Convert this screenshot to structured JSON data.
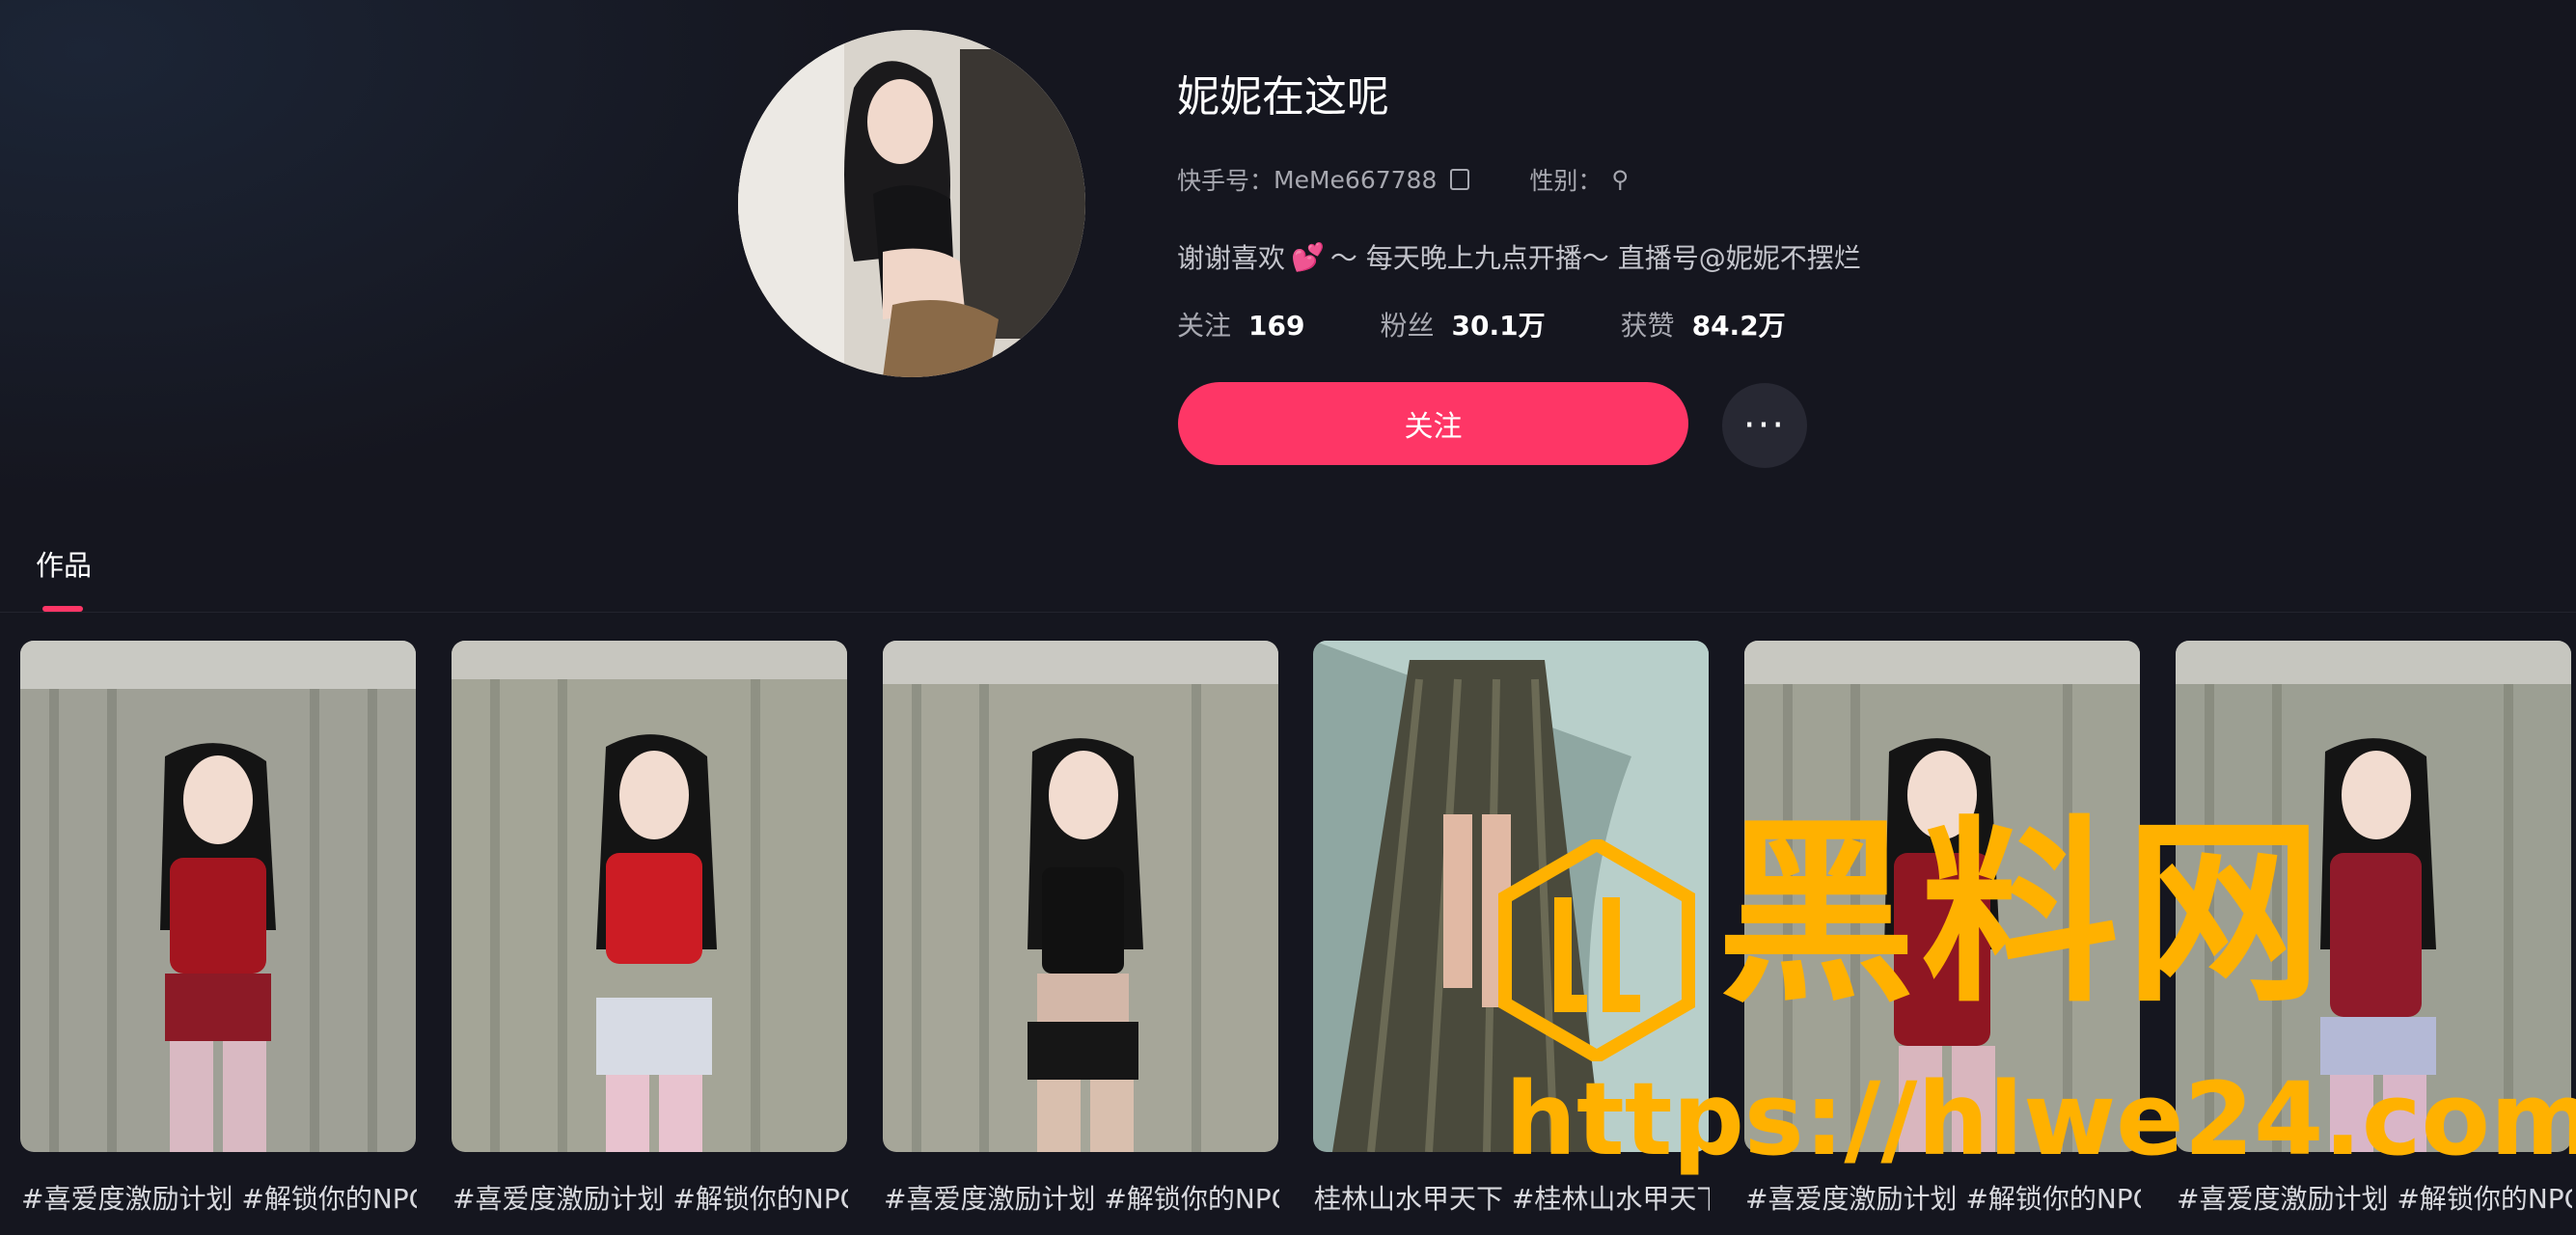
{
  "profile": {
    "name": "妮妮在这呢",
    "kuaishou_id_label": "快手号：",
    "kuaishou_id": "MeMe667788",
    "gender_label": "性别：",
    "bio_before": "谢谢喜欢",
    "bio_after": "～ 每天晚上九点开播～ 直播号@妮妮不摆烂",
    "stats": {
      "following_label": "关注",
      "following": "169",
      "followers_label": "粉丝",
      "followers": "30.1万",
      "likes_label": "获赞",
      "likes": "84.2万"
    },
    "follow_button": "关注",
    "more_button": "···"
  },
  "tabs": [
    {
      "label": "作品",
      "active": true
    }
  ],
  "videos": [
    {
      "caption": "#喜爱度激励计划 #解锁你的NPC人生"
    },
    {
      "caption": "#喜爱度激励计划 #解锁你的NPC人生"
    },
    {
      "caption": "#喜爱度激励计划 #解锁你的NPC人生"
    },
    {
      "caption": "桂林山水甲天下 #桂林山水甲天下"
    },
    {
      "caption": "#喜爱度激励计划 #解锁你的NPC人生"
    },
    {
      "caption": "#喜爱度激励计划 #解锁你的NPC人生"
    }
  ],
  "watermark": {
    "text": "黑料网",
    "url": "https://hlwe24.com"
  },
  "colors": {
    "background": "#15161f",
    "accent": "#fe3666",
    "watermark": "#ffb100"
  },
  "icons": [
    "copy-icon",
    "search-icon",
    "heart-icon",
    "more-icon"
  ]
}
